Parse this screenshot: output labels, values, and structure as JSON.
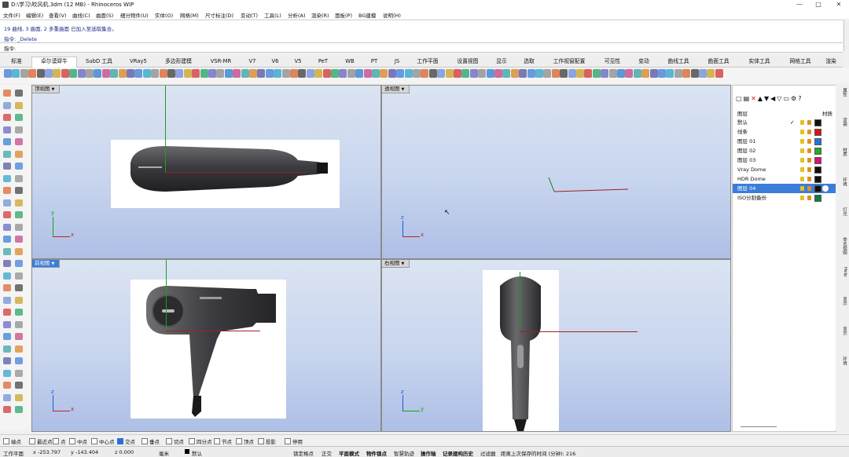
{
  "window": {
    "title": "D:\\学习\\吹风机.3dm (12 MB) - Rhinoceros WIP",
    "controls": [
      "—",
      "□",
      "✕"
    ]
  },
  "menu": [
    "文件(F)",
    "编辑(E)",
    "查看(V)",
    "曲线(C)",
    "曲面(S)",
    "细分物件(U)",
    "实体(O)",
    "网格(M)",
    "尺寸标注(D)",
    "变动(T)",
    "工具(L)",
    "分析(A)",
    "渲染(R)",
    "面板(P)",
    "BG建模",
    "说明(H)"
  ],
  "history": {
    "line1": "19 曲线, 3 曲面, 2 多重曲面 已加入至选取集合。",
    "line2": "指令: _Delete"
  },
  "command": {
    "label": "指令:",
    "value": ""
  },
  "tabs": [
    "标准",
    "卓尔谟犀牛",
    "SubD 工具",
    "VRay5",
    "多边形建模",
    "VSR-MR",
    "V7",
    "V6",
    "V5",
    "PeT",
    "WB",
    "PT",
    "JS",
    "工作平面",
    "设置视图",
    "显示",
    "选取",
    "工作视窗配置",
    "可见性",
    "变动",
    "曲线工具",
    "曲面工具",
    "实体工具",
    "网格工具",
    "渲染"
  ],
  "active_tab": "卓尔谟犀牛",
  "viewports": {
    "top": {
      "label": "顶视图",
      "x_axis": "x",
      "y_axis": "y"
    },
    "perspective": {
      "label": "透视图",
      "x_axis": "x",
      "y_axis": "z"
    },
    "front": {
      "label": "前视图",
      "x_axis": "x",
      "y_axis": "z"
    },
    "right": {
      "label": "右视图",
      "x_axis": "y",
      "y_axis": "z"
    }
  },
  "layers": {
    "header_layer": "图层",
    "header_material": "材质",
    "rows": [
      {
        "name": "默认",
        "color": "#111111",
        "current": true
      },
      {
        "name": "线条",
        "color": "#e01010"
      },
      {
        "name": "图层 01",
        "color": "#1e78d8"
      },
      {
        "name": "图层 02",
        "color": "#20b020"
      },
      {
        "name": "图层 03",
        "color": "#e0107a"
      },
      {
        "name": "Vray Dome",
        "color": "#111111"
      },
      {
        "name": "HDR Dome",
        "color": "#111111"
      },
      {
        "name": "图层 04",
        "color": "#111111",
        "selected": true
      },
      {
        "name": "ISO分割备份",
        "color": "#108040"
      }
    ]
  },
  "side_strip": [
    "属性",
    "渲染",
    "材质",
    "环境",
    "灯光",
    "命名视图",
    "Help",
    "显示",
    "显示",
    "环境"
  ],
  "osnaps": [
    {
      "label": "端点",
      "on": false
    },
    {
      "label": "最近点",
      "on": false
    },
    {
      "label": "点",
      "on": false
    },
    {
      "label": "中点",
      "on": false
    },
    {
      "label": "中心点",
      "on": false
    },
    {
      "label": "交点",
      "on": true
    },
    {
      "label": "垂点",
      "on": false
    },
    {
      "label": "切点",
      "on": false
    },
    {
      "label": "四分点",
      "on": false
    },
    {
      "label": "节点",
      "on": false
    },
    {
      "label": "顶点",
      "on": false
    },
    {
      "label": "投影",
      "on": false
    },
    {
      "label": "停用",
      "on": false
    }
  ],
  "status": {
    "cplane": "工作平面",
    "x": "x -253.797",
    "y": "y -143.404",
    "z": "z 0.000",
    "unit": "毫米",
    "layer": "默认",
    "lock_grid": "锁定格点",
    "ortho": "正交",
    "planar": "平面模式",
    "osnap": "物件锁点",
    "smart_track": "智慧轨迹",
    "gumball": "操作轴",
    "history": "记录建构历史",
    "filter": "过滤器",
    "autosave": "距离上次保存的时间 (分钟): 216"
  }
}
